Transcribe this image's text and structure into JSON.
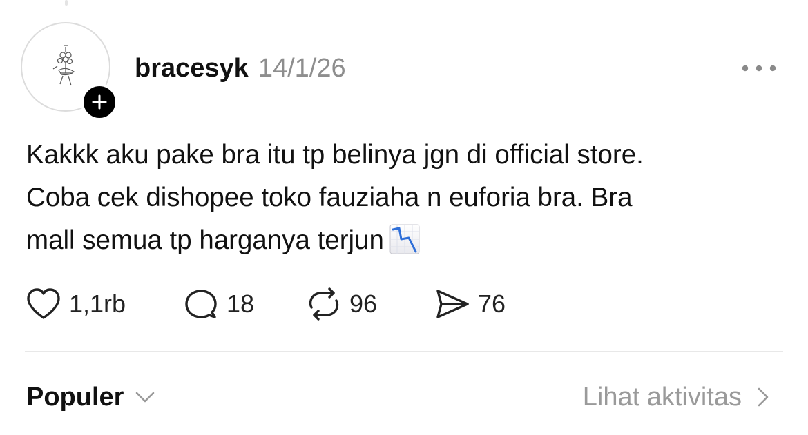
{
  "post": {
    "username": "bracesyk",
    "timestamp": "14/1/26",
    "text_lines": [
      "Kakkk aku pake bra itu tp belinya jgn di official store.",
      "Coba cek dishopee toko fauziaha n euforia bra. Bra",
      "mall semua tp harganya terjun"
    ],
    "emoji": "chart-decreasing-emoji"
  },
  "actions": {
    "likes": "1,1rb",
    "replies": "18",
    "reposts": "96",
    "shares": "76"
  },
  "footer": {
    "sort_label": "Populer",
    "activity_label": "Lihat aktivitas"
  },
  "icons": {
    "more": "more-horizontal-icon",
    "follow": "plus-icon",
    "like": "heart-icon",
    "reply": "comment-icon",
    "repost": "repost-icon",
    "share": "send-icon",
    "sort": "chevron-down-icon",
    "activity": "chevron-right-icon"
  },
  "colors": {
    "text": "#111111",
    "muted": "#8e8e8e",
    "divider": "#e8e8e8",
    "badge": "#000000"
  }
}
